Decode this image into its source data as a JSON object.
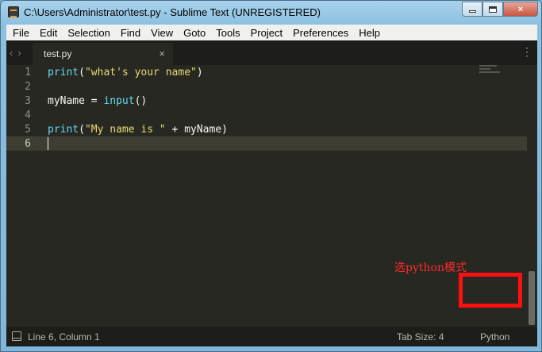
{
  "window": {
    "title": "C:\\Users\\Administrator\\test.py - Sublime Text (UNREGISTERED)",
    "controls": {
      "minimize": "minimize-icon",
      "maximize": "maximize-icon",
      "close": "×"
    }
  },
  "menu": [
    "File",
    "Edit",
    "Selection",
    "Find",
    "View",
    "Goto",
    "Tools",
    "Project",
    "Preferences",
    "Help"
  ],
  "tabs": [
    {
      "label": "test.py",
      "close": "×",
      "active": true
    }
  ],
  "nav": {
    "back": "‹",
    "forward": "›"
  },
  "tab_menu": "⋮",
  "editor": {
    "line_numbers": [
      "1",
      "2",
      "3",
      "4",
      "5",
      "6"
    ],
    "current_line": 6,
    "lines": [
      {
        "fn": "print",
        "open": "(",
        "str": "\"what's your name\"",
        "rest": ")"
      },
      {
        "plain": ""
      },
      {
        "var": "myName = ",
        "fn": "input",
        "rest": "()"
      },
      {
        "plain": ""
      },
      {
        "fn": "print",
        "open": "(",
        "str": "\"My name is \"",
        "rest": " + myName)"
      },
      {
        "plain": ""
      }
    ],
    "colors": {
      "background": "#272822",
      "function": "#66d9ef",
      "string": "#e6db74",
      "text": "#f8f8f2"
    }
  },
  "annotation": "选python模式",
  "status": {
    "position": "Line 6, Column 1",
    "tab_size": "Tab Size: 4",
    "syntax": "Python"
  },
  "accent": {
    "annotation_red": "#ff1010"
  }
}
